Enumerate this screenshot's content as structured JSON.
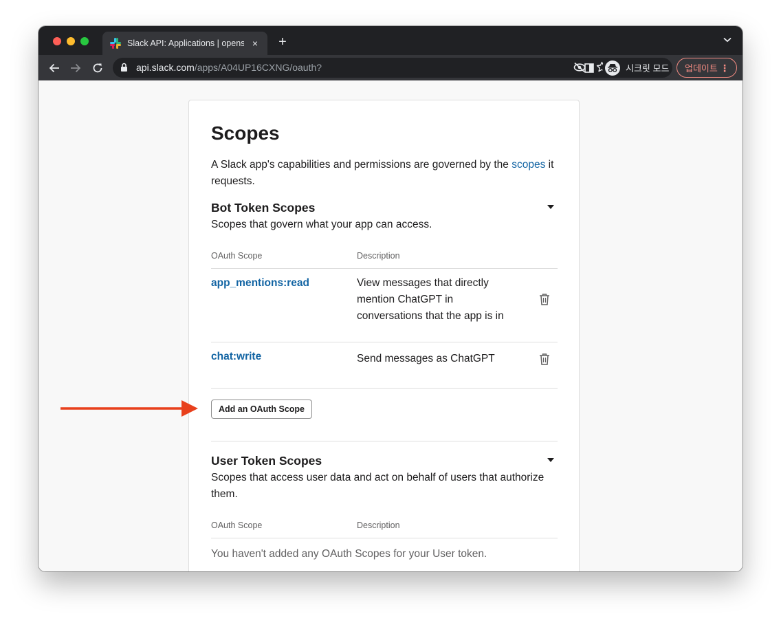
{
  "browser": {
    "tab_title": "Slack API: Applications | opens",
    "tab_close": "×",
    "new_tab": "+",
    "url_host": "api.slack.com",
    "url_path": "/apps/A04UP16CXNG/oauth?",
    "incognito_label": "시크릿 모드",
    "update_label": "업데이트",
    "menu_dots": "⋮"
  },
  "page": {
    "title": "Scopes",
    "intro_before": "A Slack app's capabilities and permissions are governed by the ",
    "intro_link": "scopes",
    "intro_after": " it requests.",
    "bot": {
      "title": "Bot Token Scopes",
      "subtitle": "Scopes that govern what your app can access.",
      "col_scope": "OAuth Scope",
      "col_desc": "Description",
      "rows": [
        {
          "scope": "app_mentions:read",
          "description": "View messages that directly mention ChatGPT in conversations that the app is in"
        },
        {
          "scope": "chat:write",
          "description": "Send messages as ChatGPT"
        }
      ],
      "add_button": "Add an OAuth Scope"
    },
    "user": {
      "title": "User Token Scopes",
      "subtitle": "Scopes that access user data and act on behalf of users that authorize them.",
      "col_scope": "OAuth Scope",
      "col_desc": "Description",
      "empty": "You haven't added any OAuth Scopes for your User token."
    }
  },
  "colors": {
    "link": "#1264a3",
    "annotation_arrow": "#e8401c",
    "update_accent": "#f28b82"
  }
}
